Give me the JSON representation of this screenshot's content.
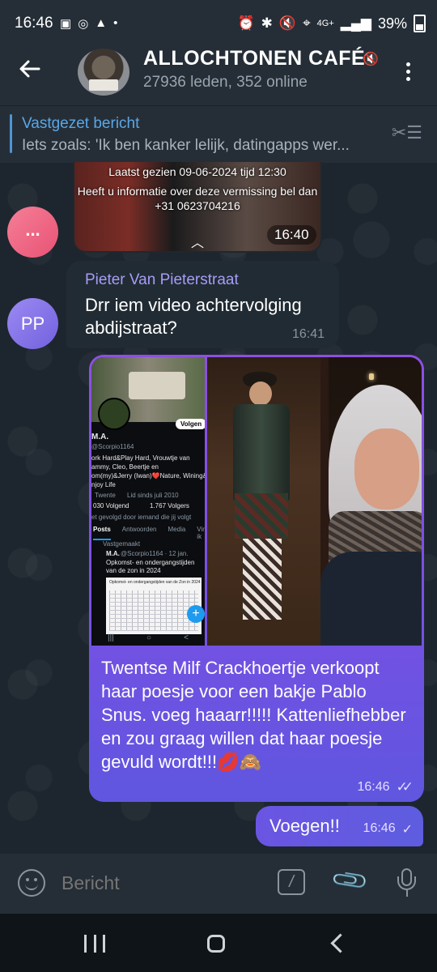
{
  "status_bar": {
    "time": "16:46",
    "network": "4G+",
    "battery": "39%"
  },
  "header": {
    "title": "ALLOCHTONEN CAFÉ",
    "subtitle": "27936 leden, 352 online"
  },
  "pinned": {
    "label": "Vastgezet bericht",
    "preview": "Iets zoals: 'Ik ben kanker lelijk, datingapps wer..."
  },
  "messages": {
    "forwarded_media": {
      "overlay_line1": "Laatst gezien 09-06-2024 tijd 12:30",
      "overlay_line2": "Heeft u informatie over deze vermissing bel dan",
      "overlay_line3": "+31 0623704216",
      "time": "16:40",
      "sender_avatar": "..."
    },
    "incoming": {
      "avatar_initials": "PP",
      "sender": "Pieter Van Pieterstraat",
      "text": "Drr iem video achtervolging abdijstraat?",
      "time": "16:41"
    },
    "outgoing_media": {
      "screenshot": {
        "follow": "Volgen",
        "name": "M.A.",
        "handle": "@Scorpio1164",
        "bio1": "ork Hard&Play Hard, Vrouwtje van",
        "bio2": "ammy, Cleo, Beertje en",
        "bio3": "om(my)&Jerry (Iwan)❤️Nature, Wining&Dining",
        "bio4": "njoy Life",
        "location": "Twente",
        "joined": "Lid sinds juli 2010",
        "following": "030 Volgend",
        "followers": "1.767 Volgers",
        "followed_by": "et gevolgd door iemand die jij volgt",
        "tabs": [
          "Posts",
          "Antwoorden",
          "Media",
          "Vind-ik"
        ],
        "pinned_label": "Vastgemaakt",
        "post_author": "M.A.",
        "post_meta": "@Scorpio1164 · 12 jan.",
        "post_text": "Opkomst- en ondergangstijden van de zon in 2024",
        "table_title": "Opkomst- en ondergangstijden van de Zon in 2024"
      },
      "caption": "Twentse Milf Crackhoertje verkoopt haar poesje voor een bakje Pablo Snus. voeg haaarr!!!!! Kattenliefhebber en zou graag willen dat haar poesje gevuld wordt!!!💋🙈",
      "time": "16:46"
    },
    "outgoing_text": {
      "text": "Voegen!!",
      "time": "16:46"
    }
  },
  "composer": {
    "placeholder": "Bericht"
  },
  "colors": {
    "accent": "#5aa7e6",
    "outgoing_bubble": "#7551e3",
    "incoming_bubble": "#212b33"
  }
}
